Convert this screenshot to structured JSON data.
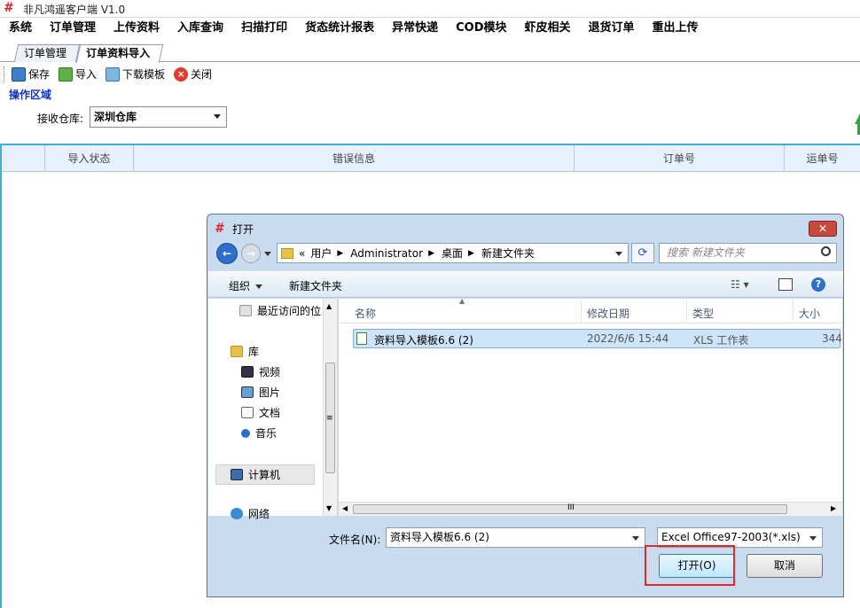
{
  "app": {
    "title": "非凡鸿遥客户端 V1.0",
    "logo": "#"
  },
  "menu": [
    "系统",
    "订单管理",
    "上传资料",
    "入库查询",
    "扫描打印",
    "货态统计报表",
    "异常快递",
    "COD模块",
    "虾皮相关",
    "退货订单",
    "重出上传"
  ],
  "tabs": [
    {
      "label": "订单管理"
    },
    {
      "label": "订单资料导入"
    }
  ],
  "toolbar": {
    "save": "保存",
    "import": "导入",
    "download": "下载模板",
    "close": "关闭"
  },
  "op_area": {
    "title": "操作区域",
    "warehouse_label": "接收仓库:",
    "warehouse_value": "深圳仓库"
  },
  "grid": {
    "columns": [
      "导入状态",
      "错误信息",
      "订单号",
      "运单号"
    ]
  },
  "dialog": {
    "title": "打开",
    "address": {
      "prefix": "«",
      "crumbs": [
        "用户",
        "Administrator",
        "桌面",
        "新建文件夹"
      ]
    },
    "search_placeholder": "搜索 新建文件夹",
    "organize": "组织",
    "new_folder": "新建文件夹",
    "nav": {
      "recent": "最近访问的位",
      "library": "库",
      "video": "视频",
      "pictures": "图片",
      "documents": "文档",
      "music": "音乐",
      "computer": "计算机",
      "network": "网络"
    },
    "columns": {
      "name": "名称",
      "date": "修改日期",
      "type": "类型",
      "size": "大小"
    },
    "file": {
      "name": "资料导入模板6.6 (2)",
      "date": "2022/6/6 15:44",
      "type": "XLS 工作表",
      "size": "344"
    },
    "filename_label": "文件名(N):",
    "filename_value": "资料导入模板6.6 (2)",
    "filetype_value": "Excel Office97-2003(*.xls)",
    "open_button": "打开(O)",
    "cancel_button": "取消",
    "hscroll_mark": "III",
    "vscroll_mark": "≡"
  }
}
